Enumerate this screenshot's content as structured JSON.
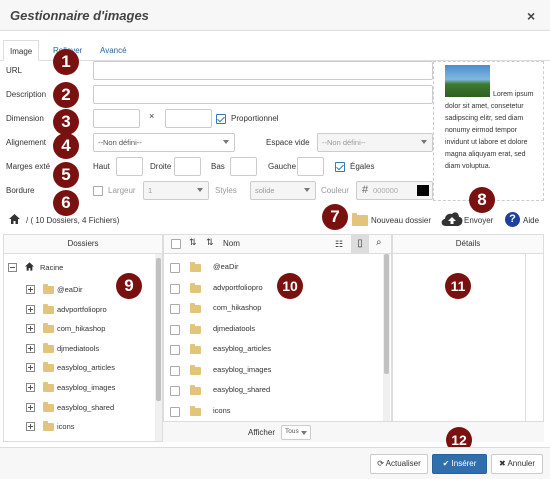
{
  "dialog": {
    "title": "Gestionnaire d'images",
    "close": "×"
  },
  "tabs": [
    {
      "label": "Image"
    },
    {
      "label": "Rollover"
    },
    {
      "label": "Avancé"
    }
  ],
  "form": {
    "url_label": "URL",
    "description_label": "Description",
    "dimension_label": "Dimension",
    "dimension_sep": "×",
    "proportional_label": "Proportionnel",
    "alignment_label": "Alignement",
    "alignment_value": "--Non défini--",
    "space_label": "Espace vide",
    "space_value": "--Non défini--",
    "margins_label": "Marges exté",
    "margin_top": "Haut",
    "margin_right": "Droite",
    "margin_bottom": "Bas",
    "margin_left": "Gauche",
    "equal_label": "Égales",
    "border_label": "Bordure",
    "width_label": "Largeur",
    "width_value": "1",
    "style_label": "Styles",
    "style_value": "solide",
    "color_label": "Couleur",
    "color_placeholder": "000000"
  },
  "preview": {
    "text": "Lorem ipsum dolor sit amet, consetetur sadipscing elitr, sed diam nonumy eirmod tempor invidunt ut labore et dolore magna aliquyam erat, sed diam voluptua."
  },
  "toolbar": {
    "path": "/ ( 10 Dossiers, 4 Fichiers)",
    "new_folder": "Nouveau dossier",
    "send": "Envoyer",
    "help": "Aide"
  },
  "panes": {
    "folders": "Dossiers",
    "name": "Nom",
    "details": "Détails"
  },
  "tree": {
    "root": "Racine",
    "items": [
      "@eaDir",
      "advportfoliopro",
      "com_hikashop",
      "djmediatools",
      "easyblog_articles",
      "easyblog_images",
      "easyblog_shared",
      "icons"
    ]
  },
  "files": [
    "@eaDir",
    "advportfoliopro",
    "com_hikashop",
    "djmediatools",
    "easyblog_articles",
    "easyblog_images",
    "easyblog_shared",
    "icons"
  ],
  "list_footer": {
    "show_label": "Afficher",
    "show_value": "Tous"
  },
  "footer": {
    "refresh": "Actualiser",
    "insert": "Insérer",
    "cancel": "Annuler"
  },
  "badges": [
    "1",
    "2",
    "3",
    "4",
    "5",
    "6",
    "7",
    "8",
    "9",
    "10",
    "11",
    "12"
  ],
  "colors": {
    "badge": "#7a1111",
    "primary": "#2f6fad",
    "link": "#2a6496",
    "folder": "#e2c47a"
  }
}
